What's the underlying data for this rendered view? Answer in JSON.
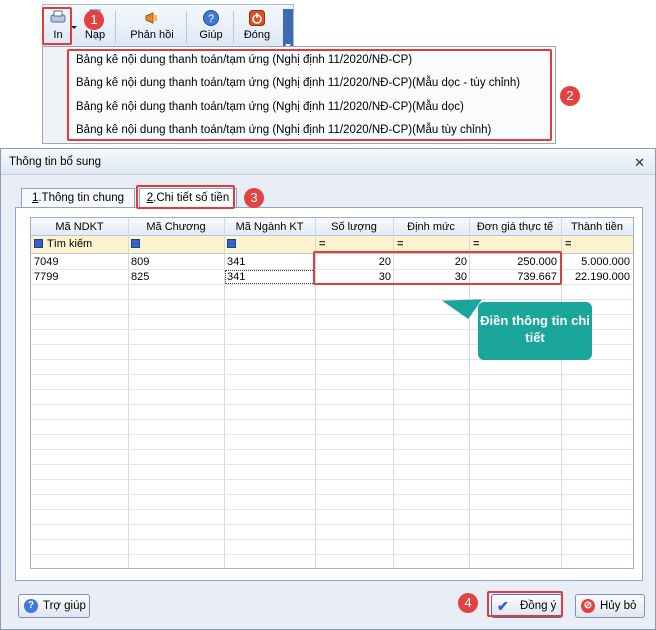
{
  "toolbar": {
    "print_label": "In",
    "load_label": "Nạp",
    "feedback_label": "Phản hồi",
    "help_label": "Giúp",
    "close_label": "Đóng"
  },
  "print_menu": [
    "Bảng kê nội dung thanh toán/tạm ứng (Nghị định 11/2020/NĐ-CP)",
    "Bảng kê nội dung thanh toán/tạm ứng (Nghị định 11/2020/NĐ-CP)(Mẫu dọc - tùy chỉnh)",
    "Bảng kê nội dung thanh toán/tạm ứng (Nghị định 11/2020/NĐ-CP)(Mẫu dọc)",
    "Bảng kê nội dung thanh toán/tạm ứng (Nghị định 11/2020/NĐ-CP)(Mẫu tùy chỉnh)"
  ],
  "step_badges": [
    "1",
    "2",
    "3",
    "4"
  ],
  "dialog": {
    "title": "Thông tin bổ sung",
    "tabs": [
      {
        "key": "1",
        "label": ".Thông tin chung"
      },
      {
        "key": "2",
        "label": ".Chi tiết số tiền"
      }
    ],
    "table": {
      "columns": [
        "Mã NDKT",
        "Mã Chương",
        "Mã Ngành KT",
        "Số lượng",
        "Định mức",
        "Đơn giá thực tế",
        "Thành tiền"
      ],
      "filter_label": "Tìm kiếm",
      "rows": [
        [
          "7049",
          "809",
          "341",
          "20",
          "20",
          "250.000",
          "5.000.000"
        ],
        [
          "7799",
          "825",
          "341",
          "30",
          "30",
          "739.667",
          "22.190.000"
        ]
      ]
    },
    "callout_text": "Điền thông tin chi tiết",
    "help_button": "Trợ giúp",
    "ok_button": "Đồng ý",
    "cancel_button": "Hủy bỏ"
  },
  "colors": {
    "highlight": "#e23b3b",
    "callout": "#1aa69a",
    "filter_row": "#fcf4cf"
  }
}
